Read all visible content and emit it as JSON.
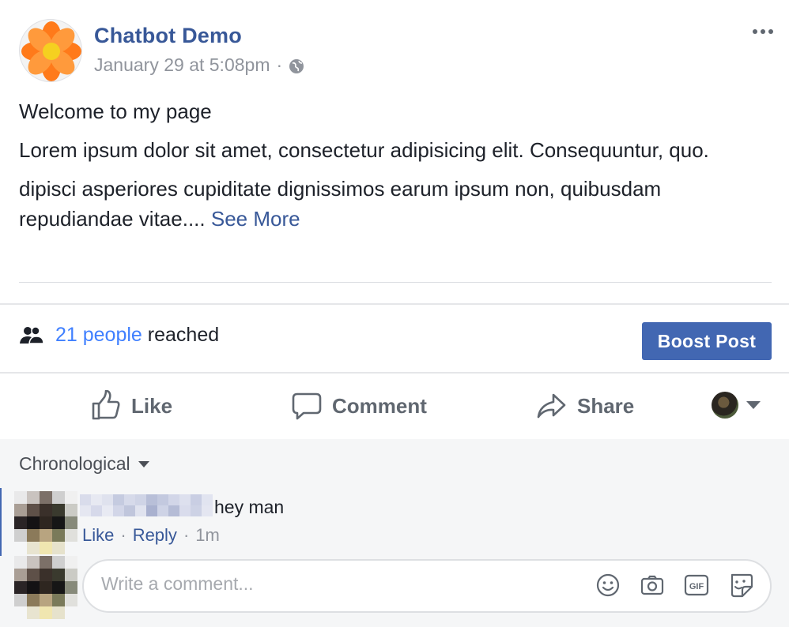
{
  "post": {
    "page_name": "Chatbot Demo",
    "timestamp": "January 29 at 5:08pm",
    "meta_separator": "·",
    "paragraphs": [
      "Welcome to my page",
      "Lorem ipsum dolor sit amet, consectetur adipisicing elit. Consequuntur, quo.",
      "dipisci asperiores cupiditate dignissimos earum ipsum non, quibusdam repudiandae vitae...."
    ],
    "see_more": "See More"
  },
  "reach": {
    "count_text": "21 people",
    "suffix": "reached",
    "boost_label": "Boost Post"
  },
  "actions": {
    "like": "Like",
    "comment": "Comment",
    "share": "Share"
  },
  "comments": {
    "sort_label": "Chronological",
    "items": [
      {
        "text": "hey man",
        "like": "Like",
        "reply": "Reply",
        "age": "1m"
      }
    ],
    "input_placeholder": "Write a comment..."
  },
  "icons": {
    "page_avatar": "flower-logo",
    "privacy": "globe-icon",
    "more": "more-horizontal-icon",
    "people": "people-icon",
    "like": "thumbs-up-icon",
    "comment": "speech-bubble-icon",
    "share": "share-arrow-icon",
    "emoji": "smiley-icon",
    "photo": "camera-icon",
    "gif": "gif-icon",
    "sticker": "sticker-icon"
  },
  "colors": {
    "link_blue": "#385898",
    "reach_blue": "#4080ff",
    "boost_button": "#4267b2",
    "muted_text": "#90949c",
    "comments_bg": "#f5f6f7"
  }
}
